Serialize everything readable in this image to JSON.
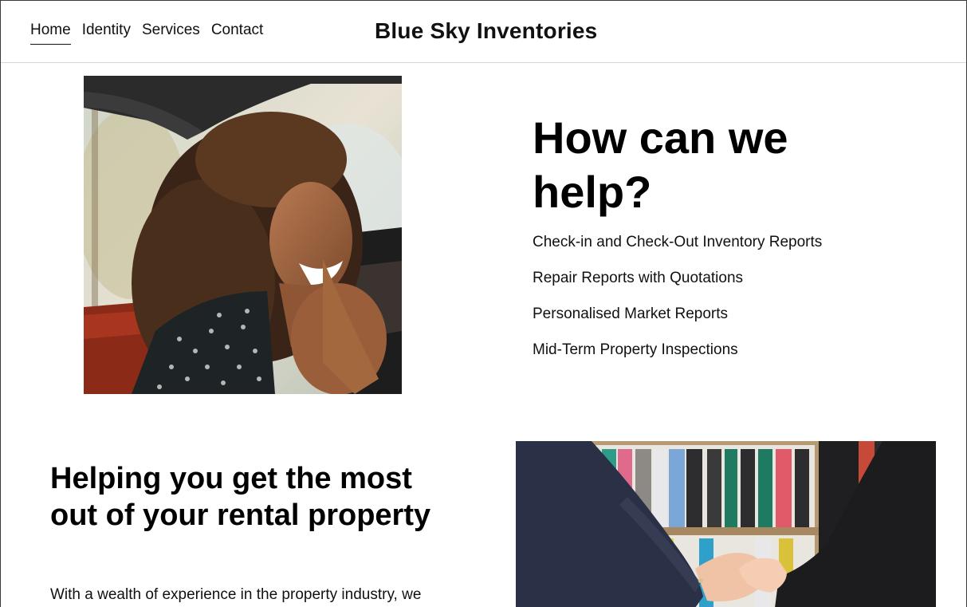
{
  "header": {
    "brand": "Blue Sky Inventories",
    "nav": [
      {
        "label": "Home",
        "active": true
      },
      {
        "label": "Identity",
        "active": false
      },
      {
        "label": "Services",
        "active": false
      },
      {
        "label": "Contact",
        "active": false
      }
    ]
  },
  "hero": {
    "title": "How can we help?",
    "image_alt": "smiling woman in car",
    "services": [
      "Check-in and Check-Out Inventory Reports",
      "Repair Reports with Quotations",
      "Personalised Market Reports",
      "Mid-Term Property Inspections"
    ]
  },
  "about": {
    "title": "Helping you get the most out of your rental property",
    "text": "With a wealth of experience in the property industry, we",
    "image_alt": "business handshake"
  }
}
